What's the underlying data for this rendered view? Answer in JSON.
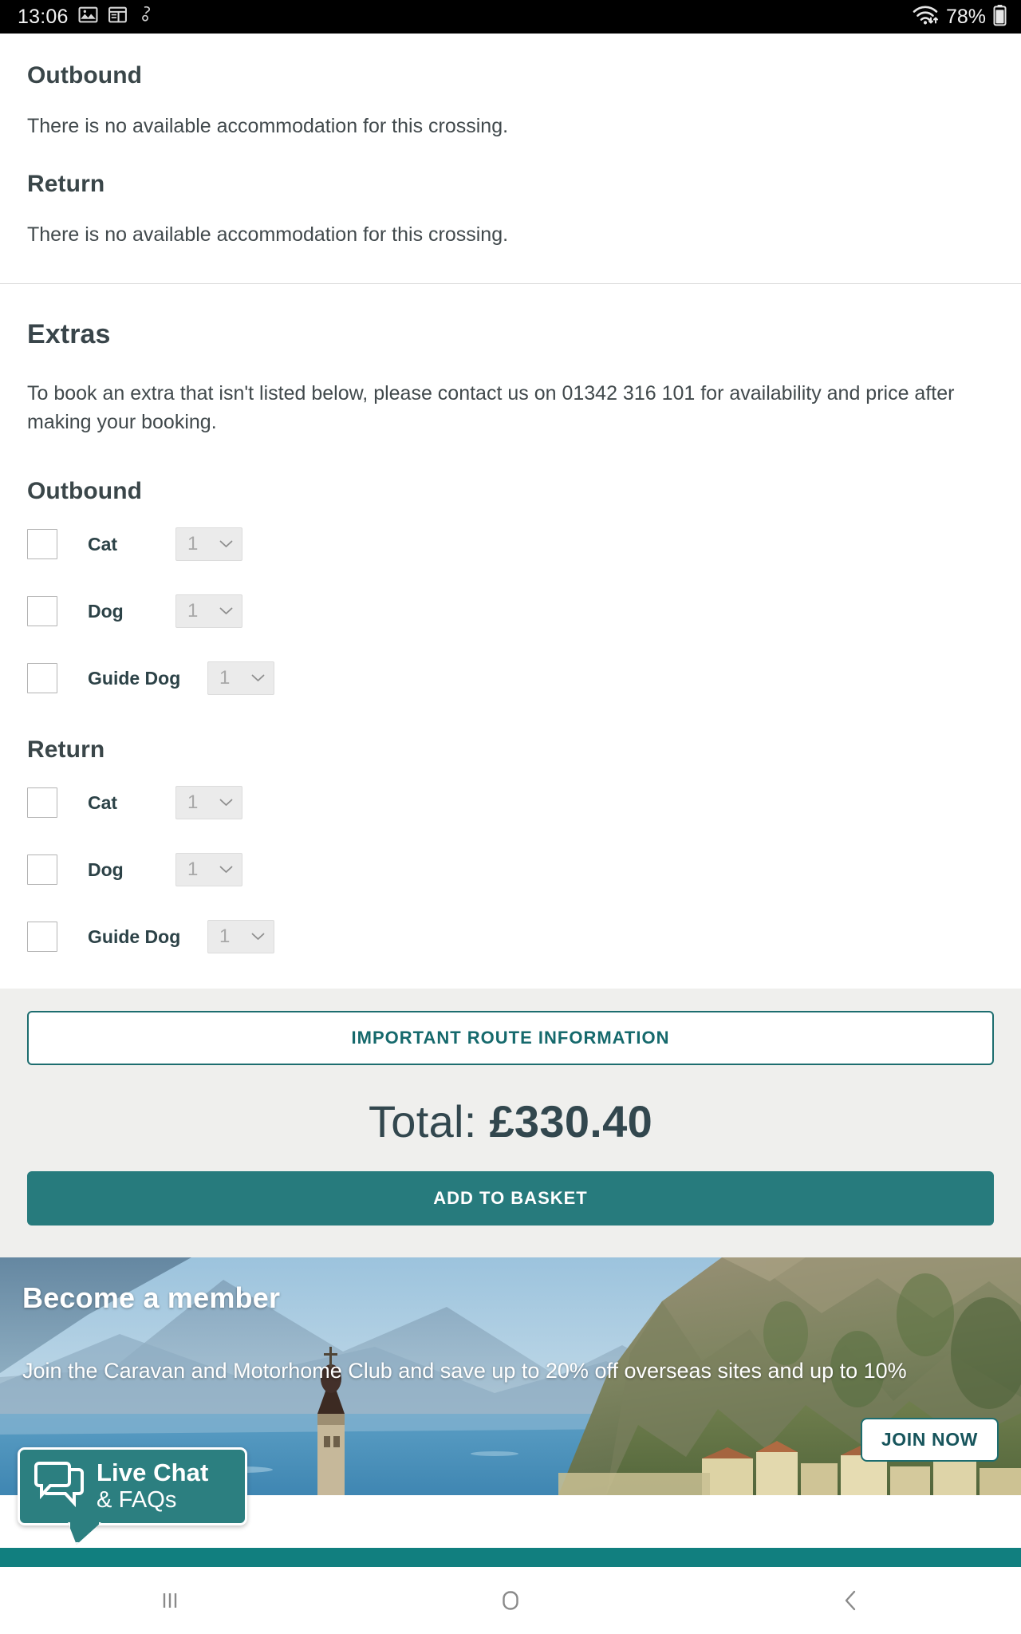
{
  "status_bar": {
    "time": "13:06",
    "battery_percent": "78%",
    "icons": [
      "image-icon",
      "layout-icon",
      "signal-icon",
      "wifi-icon",
      "battery-icon"
    ]
  },
  "accommodation": {
    "outbound_heading": "Outbound",
    "outbound_message": "There is no available accommodation for this crossing.",
    "return_heading": "Return",
    "return_message": "There is no available accommodation for this crossing."
  },
  "extras": {
    "heading": "Extras",
    "intro": "To book an extra that isn't listed below, please contact us on 01342 316 101 for availability and price after making your booking.",
    "outbound_heading": "Outbound",
    "return_heading": "Return",
    "outbound_items": [
      {
        "label": "Cat",
        "quantity": "1",
        "checked": false
      },
      {
        "label": "Dog",
        "quantity": "1",
        "checked": false
      },
      {
        "label": "Guide Dog",
        "quantity": "1",
        "checked": false
      }
    ],
    "return_items": [
      {
        "label": "Cat",
        "quantity": "1",
        "checked": false
      },
      {
        "label": "Dog",
        "quantity": "1",
        "checked": false
      },
      {
        "label": "Guide Dog",
        "quantity": "1",
        "checked": false
      }
    ]
  },
  "footer": {
    "route_info_label": "IMPORTANT ROUTE INFORMATION",
    "total_label": "Total:",
    "total_value": "£330.40",
    "add_to_basket_label": "ADD TO BASKET"
  },
  "banner": {
    "title": "Become a member",
    "subtitle": "Join the Caravan and Motorhome Club and save up to 20% off overseas sites and up to 10%",
    "join_label": "JOIN NOW"
  },
  "live_chat": {
    "line1": "Live Chat",
    "line2": "& FAQs"
  },
  "nav_bar": {
    "recents": "recents-icon",
    "home": "home-icon",
    "back": "back-icon"
  },
  "colors": {
    "teal": "#277b7d",
    "teal_dark": "#1d6d6f",
    "slate": "#32474e",
    "footer_bg": "#efefed"
  }
}
